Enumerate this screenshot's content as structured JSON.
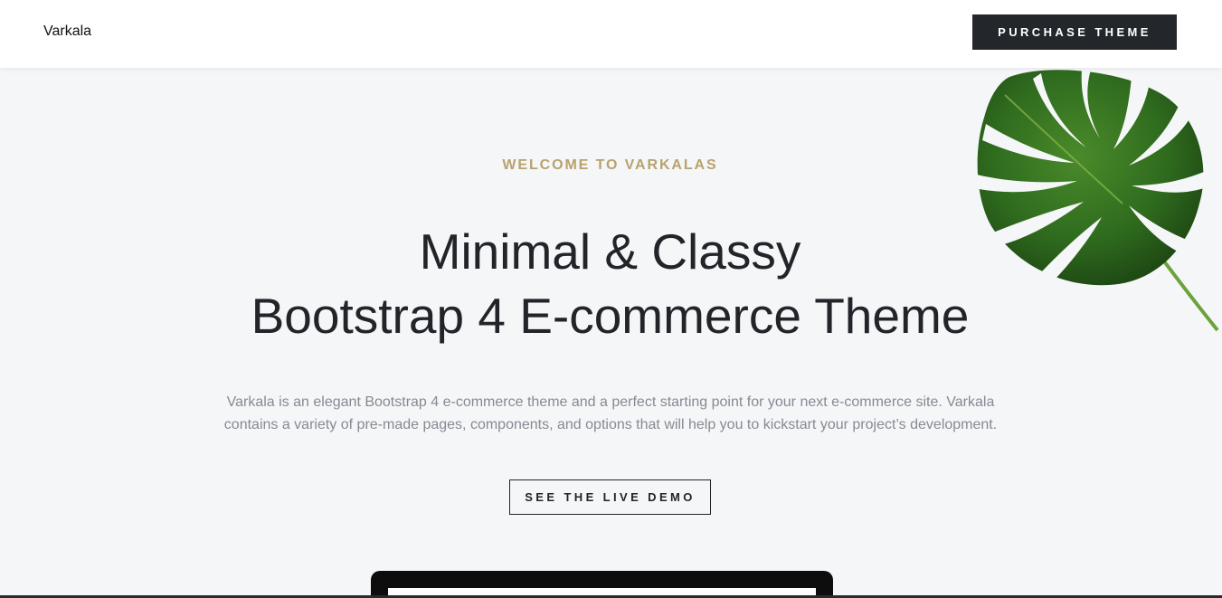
{
  "navbar": {
    "brand": "Varkala",
    "purchase_label": "PURCHASE THEME"
  },
  "hero": {
    "eyebrow": "WELCOME TO VARKALAS",
    "headline_line1": "Minimal & Classy",
    "headline_line2": "Bootstrap 4 E-commerce Theme",
    "lead": "Varkala is an elegant Bootstrap 4 e-commerce theme and a perfect starting point for your next e-commerce site. Varkala contains a variety of pre-made pages, components, and options that will help you to kickstart your project’s development.",
    "cta_label": "SEE THE LIVE DEMO"
  },
  "colors": {
    "accent": "#b8a26e",
    "dark": "#23262b",
    "background": "#f5f6f8",
    "muted_text": "#858b93",
    "leaf_green": "#2f6b1e"
  },
  "icons": {
    "decoration": "monstera-leaf"
  }
}
